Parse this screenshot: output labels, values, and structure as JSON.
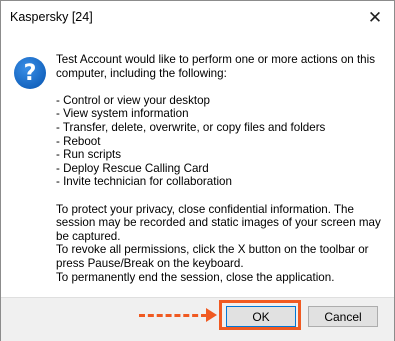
{
  "window": {
    "title": "Kaspersky [24]",
    "close_glyph": "✕"
  },
  "icon": {
    "name": "question-icon",
    "glyph": "?",
    "color": "#1565c0"
  },
  "message": {
    "intro": "Test Account would like to perform one or more actions on this computer, including the following:",
    "actions": [
      "- Control or view your desktop",
      "- View system information",
      "- Transfer, delete, overwrite, or copy files and folders",
      "- Reboot",
      "- Run scripts",
      "- Deploy Rescue Calling Card",
      "- Invite technician for collaboration"
    ],
    "privacy": "To protect your privacy, close confidential information. The session may be recorded and static images of your screen may be captured.",
    "revoke": "To revoke all permissions, click the X button on the toolbar or press Pause/Break on the keyboard.",
    "end": "To permanently end the session, close the application."
  },
  "buttons": {
    "ok": "OK",
    "cancel": "Cancel"
  },
  "annotation": {
    "color": "#f05a22"
  }
}
